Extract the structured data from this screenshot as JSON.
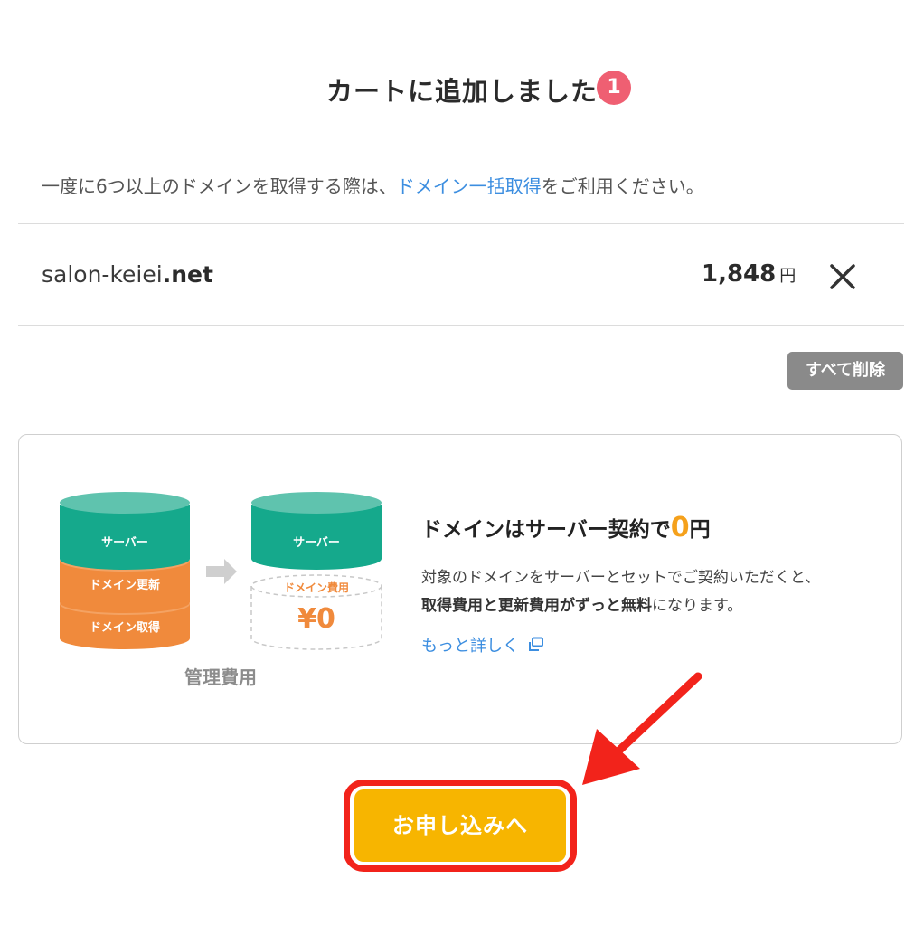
{
  "dialog": {
    "title": "カートに追加しました",
    "cart_count": "1"
  },
  "notice": {
    "before": "一度に6つ以上のドメインを取得する際は、",
    "link": "ドメイン一括取得",
    "after": "をご利用ください。"
  },
  "cart_item": {
    "domain_name": "salon-keiei",
    "domain_tld": ".net",
    "price": "1,848",
    "currency": "円",
    "remove_icon": "close-icon"
  },
  "remove_all_label": "すべて削除",
  "promo": {
    "illustration": {
      "left_server": "サーバー",
      "left_renew": "ドメイン更新",
      "left_acquire": "ドメイン取得",
      "right_server": "サーバー",
      "right_domain_fee": "ドメイン費用",
      "right_amount": "¥0",
      "caption": "管理費用",
      "arrow_icon": "arrow-right-icon"
    },
    "title_before": "ドメインはサーバー契約で",
    "title_zero": "0",
    "title_after": "円",
    "line1": "対象のドメインをサーバーとセットでご契約いただくと、",
    "line2_bold": "取得費用と更新費用がずっと無料",
    "line2_rest": "になります。",
    "more_link": "もっと詳しく",
    "more_icon": "external-link-icon"
  },
  "apply_label": "お申し込みへ",
  "colors": {
    "accent_orange": "#f7b500",
    "badge_red": "#ef5f72",
    "teal": "#15a98c",
    "domain_orange": "#f08a3c",
    "link_blue": "#3c8ee0",
    "highlight_red": "#f2231b"
  }
}
